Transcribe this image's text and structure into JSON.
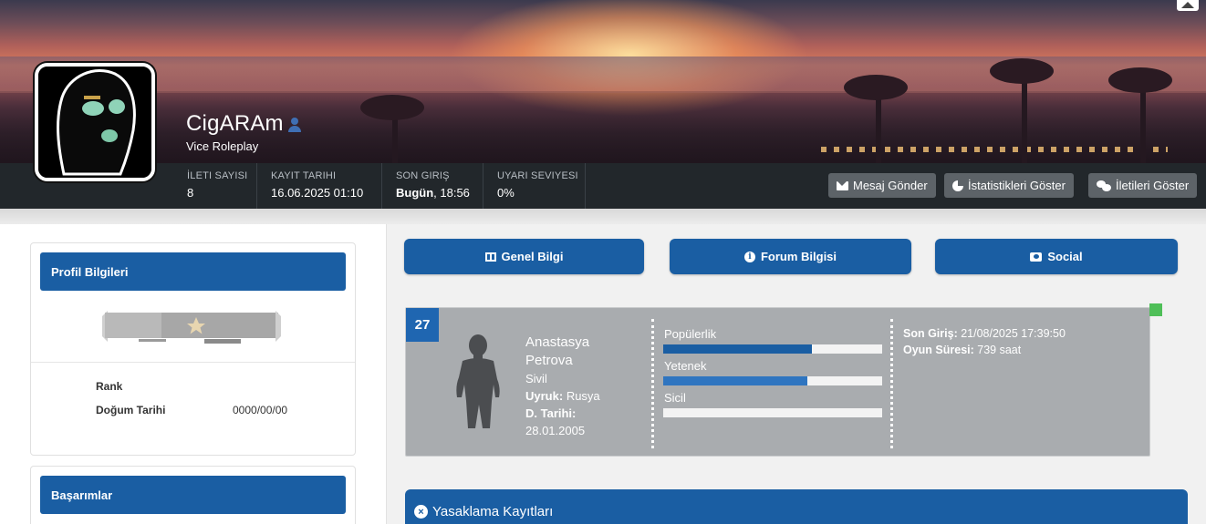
{
  "profile": {
    "username": "CigARAm",
    "subtitle": "Vice Roleplay"
  },
  "stats": [
    {
      "key": "İLETI SAYISI",
      "value": "8"
    },
    {
      "key": "KAYIT TARIHI",
      "value": "16.06.2025 01:10"
    },
    {
      "key": "SON GIRIŞ",
      "value_bold": "Bugün",
      "value_rest": ", 18:56"
    },
    {
      "key": "UYARI SEVIYESI",
      "value": "0%"
    }
  ],
  "actions": {
    "message": "Mesaj Gönder",
    "statistics": "İstatistikleri Göster",
    "posts": "İletileri Göster"
  },
  "profile_info": {
    "title": "Profil Bilgileri",
    "rows": [
      {
        "label": "Rank",
        "value": ""
      },
      {
        "label": "Doğum Tarihi",
        "value": "0000/00/00"
      }
    ]
  },
  "achievements": {
    "title": "Başarımlar"
  },
  "tabs": [
    {
      "label": "Genel Bilgi",
      "icon": "columns-icon"
    },
    {
      "label": "Forum Bilgisi",
      "icon": "info-icon"
    },
    {
      "label": "Social",
      "icon": "camera-icon"
    }
  ],
  "character": {
    "level": "27",
    "first_name": "Anastasya",
    "last_name": "Petrova",
    "role": "Sivil",
    "nationality_label": "Uyruk:",
    "nationality": "Rusya",
    "dob_label": "D. Tarihi:",
    "dob": "28.01.2005",
    "bars": [
      {
        "label": "Popülerlik",
        "value": 0.68,
        "color": "#1a5ea3"
      },
      {
        "label": "Yetenek",
        "value": 0.66,
        "color": "#2f75c0"
      },
      {
        "label": "Sicil",
        "value": 0.0,
        "color": "#2f75c0"
      }
    ],
    "last_login_label": "Son Giriş:",
    "last_login": "21/08/2025 17:39:50",
    "playtime_label": "Oyun Süresi:",
    "playtime": "739 saat",
    "status_color": "#4fbf58"
  },
  "ban_panel": {
    "title": "Yasaklama Kayıtları"
  },
  "colors": {
    "primary": "#1a5ea3",
    "statsbar": "#22272b",
    "card": "#a9acaf"
  }
}
